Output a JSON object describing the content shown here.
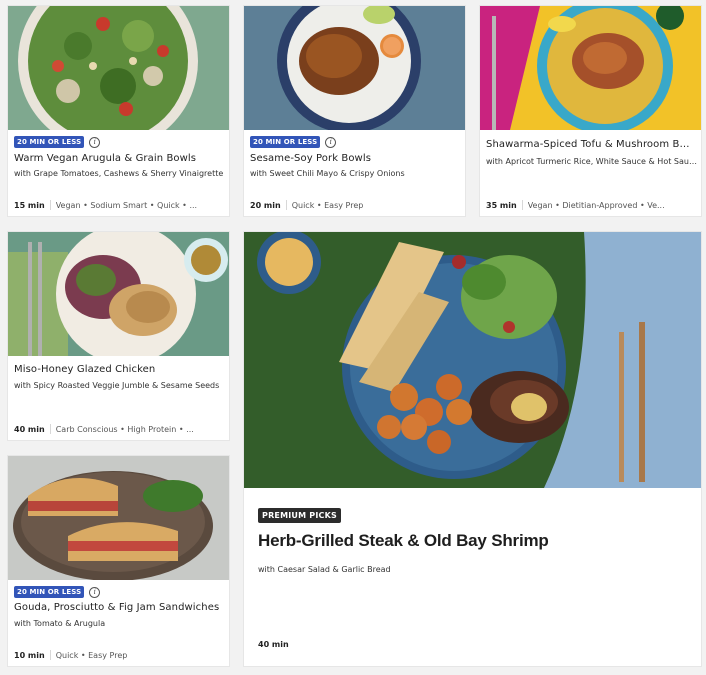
{
  "cards": [
    {
      "badge": "20 MIN OR LESS",
      "title": "Warm Vegan Arugula & Grain Bowls",
      "subtitle": "with Grape Tomatoes, Cashews & Sherry Vinaigrette",
      "time": "15 min",
      "tags": "Vegan • Sodium Smart • Quick • ..."
    },
    {
      "badge": "20 MIN OR LESS",
      "title": "Sesame-Soy Pork Bowls",
      "subtitle": "with Sweet Chili Mayo & Crispy Onions",
      "time": "20 min",
      "tags": "Quick • Easy Prep"
    },
    {
      "title": "Shawarma-Spiced Tofu & Mushroom Bo...",
      "subtitle": "with Apricot Turmeric Rice, White Sauce & Hot Sauce",
      "time": "35 min",
      "tags": "Vegan • Dietitian-Approved • Ve..."
    },
    {
      "title": "Miso-Honey Glazed Chicken",
      "subtitle": "with Spicy Roasted Veggie Jumble & Sesame Seeds",
      "time": "40 min",
      "tags": "Carb Conscious • High Protein • ..."
    },
    {
      "badge": "20 MIN OR LESS",
      "title": "Gouda, Prosciutto & Fig Jam Sandwiches",
      "subtitle": "with Tomato & Arugula",
      "time": "10 min",
      "tags": "Quick • Easy Prep"
    }
  ],
  "featured": {
    "badge": "PREMIUM PICKS",
    "title": "Herb-Grilled Steak & Old Bay Shrimp",
    "subtitle": "with Caesar Salad & Garlic Bread",
    "time": "40 min"
  },
  "info_icon": "i"
}
